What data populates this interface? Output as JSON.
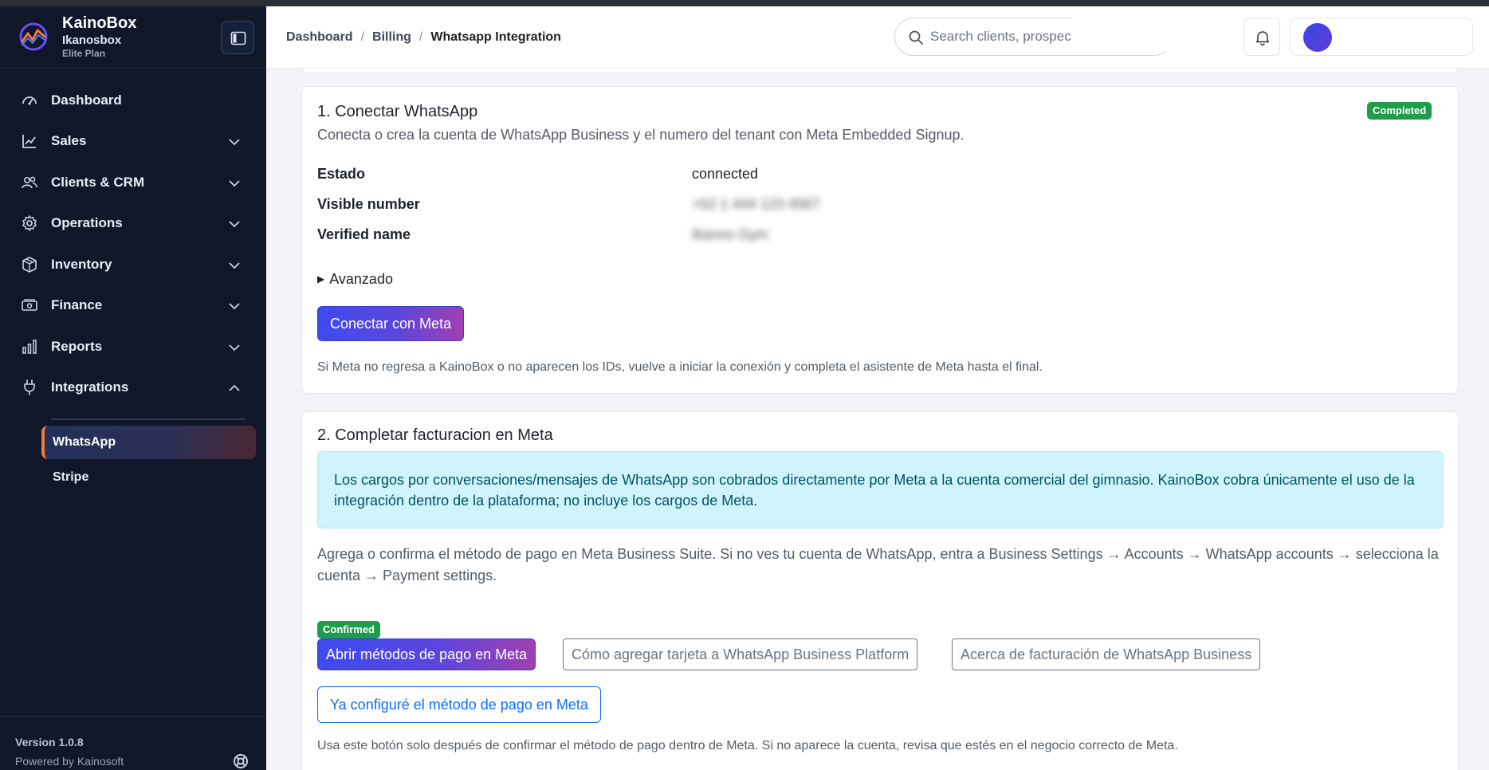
{
  "brand": {
    "name": "KainoBox",
    "tenant": "Ikanosbox",
    "plan": "Elite Plan"
  },
  "sidebar": {
    "items": [
      {
        "label": "Dashboard",
        "icon": "gauge-icon"
      },
      {
        "label": "Sales",
        "icon": "chart-line-icon"
      },
      {
        "label": "Clients & CRM",
        "icon": "users-icon"
      },
      {
        "label": "Operations",
        "icon": "gear-icon"
      },
      {
        "label": "Inventory",
        "icon": "box-icon"
      },
      {
        "label": "Finance",
        "icon": "cash-icon"
      },
      {
        "label": "Reports",
        "icon": "bar-chart-icon"
      },
      {
        "label": "Integrations",
        "icon": "plug-icon"
      }
    ],
    "sub_items": [
      {
        "label": "WhatsApp",
        "active": true
      },
      {
        "label": "Stripe",
        "active": false
      }
    ],
    "version": "Version 1.0.8",
    "powered_by": "Powered by Kainosoft"
  },
  "header": {
    "breadcrumbs": [
      "Dashboard",
      "Billing",
      "Whatsapp Integration"
    ],
    "search_placeholder": "Search clients, prospects, sales..."
  },
  "step1": {
    "title": "1. Conectar WhatsApp",
    "description": "Conecta o crea la cuenta de WhatsApp Business y el numero del tenant con Meta Embedded Signup.",
    "status_badge": "Completed",
    "fields": [
      {
        "label": "Estado",
        "value": "connected",
        "blurred": false
      },
      {
        "label": "Visible number",
        "value": "+52 1 444 123 4567",
        "blurred": true
      },
      {
        "label": "Verified name",
        "value": "Ikanos Gym",
        "blurred": true
      }
    ],
    "advanced_label": "Avanzado",
    "connect_button": "Conectar con Meta",
    "note": "Si Meta no regresa a KainoBox o no aparecen los IDs, vuelve a iniciar la conexión y completa el asistente de Meta hasta el final."
  },
  "step2": {
    "title": "2. Completar facturacion en Meta",
    "info": "Los cargos por conversaciones/mensajes de WhatsApp son cobrados directamente por Meta a la cuenta comercial del gimnasio. KainoBox cobra únicamente el uso de la integración dentro de la plataforma; no incluye los cargos de Meta.",
    "instructions": "Agrega o confirma el método de pago en Meta Business Suite. Si no ves tu cuenta de WhatsApp, entra a Business Settings → Accounts → WhatsApp accounts → selecciona la cuenta → Payment settings.",
    "status_badge": "Confirmed",
    "open_payment_button": "Abrir métodos de pago en Meta",
    "how_to_button": "Cómo agregar tarjeta a WhatsApp Business Platform",
    "about_button": "Acerca de facturación de WhatsApp Business",
    "confirm_button": "Ya configuré el método de pago en Meta",
    "note": "Usa este botón solo después de confirmar el método de pago dentro de Meta. Si no aparece la cuenta, revisa que estés en el negocio correcto de Meta."
  },
  "colors": {
    "sidebar_bg": "#0f1729",
    "success": "#1f9d4c",
    "info_bg": "#cff4fc",
    "primary_blue": "#0d6efd",
    "accent_orange": "#f07a3a"
  }
}
